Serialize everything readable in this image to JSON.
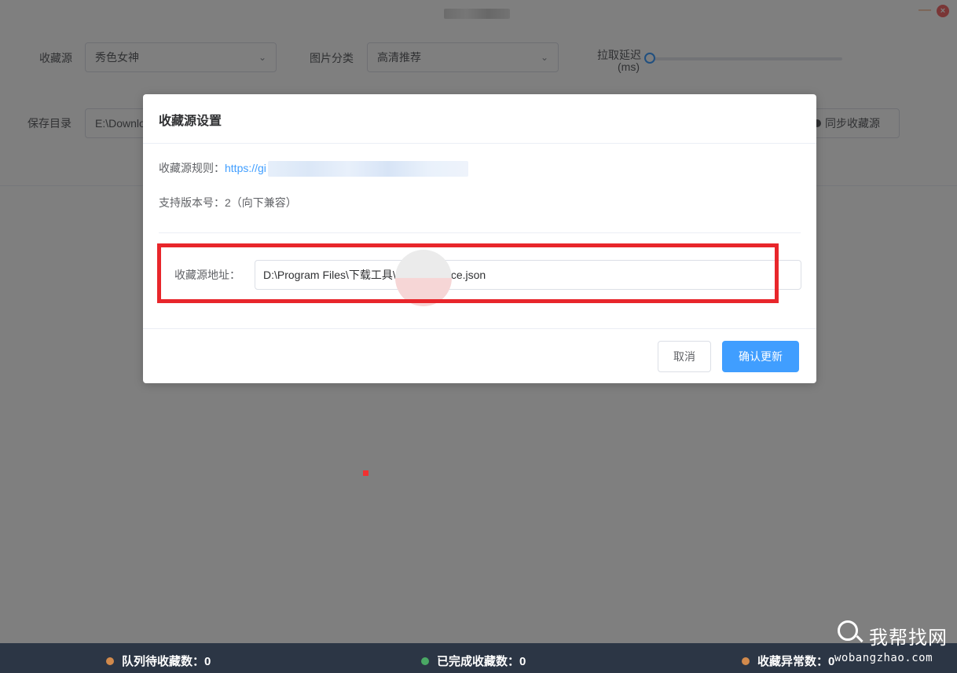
{
  "window": {
    "minimize_glyph": "—",
    "close_glyph": "×"
  },
  "form": {
    "source_label": "收藏源",
    "source_value": "秀色女神",
    "category_label": "图片分类",
    "category_value": "高清推荐",
    "delay_label_line1": "拉取延迟",
    "delay_label_line2": "(ms)",
    "delay_value_fraction": 0,
    "save_dir_label": "保存目录",
    "save_dir_value": "E:\\Downlo",
    "sync_button": "同步收藏源"
  },
  "statusbar": {
    "queue_label": "队列待收藏数：0",
    "done_label": "已完成收藏数：0",
    "error_label": "收藏异常数：0",
    "queue_color": "#e6a23c",
    "done_color": "#67c23a",
    "error_color": "#e6a23c"
  },
  "dialog": {
    "title": "收藏源设置",
    "rule_label": "收藏源规则：",
    "rule_link": "https://gi",
    "version_text": "支持版本号：2（向下兼容）",
    "address_label": "收藏源地址：",
    "address_value": "D:\\Program Files\\下载工具\\reptile-source.json",
    "cancel_button": "取消",
    "confirm_button": "确认更新"
  },
  "watermark": {
    "cn": "我帮找网",
    "en": "wobangzhao.com"
  },
  "colors": {
    "accent": "#409eff",
    "highlight": "#e8262b",
    "statusbar_bg": "#2c3645"
  }
}
